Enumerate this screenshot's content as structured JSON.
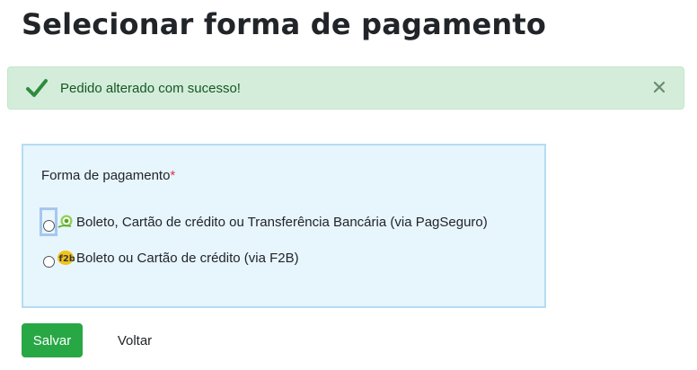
{
  "page": {
    "title": "Selecionar forma de pagamento"
  },
  "alert": {
    "message": "Pedido alterado com sucesso!",
    "icon": "check-icon",
    "close_icon": "close-icon",
    "color": "#d4edda"
  },
  "form": {
    "label": "Forma de pagamento",
    "required_mark": "*",
    "options": [
      {
        "label": "Boleto, Cartão de crédito ou Transferência Bancária (via PagSeguro)",
        "icon": "pagseguro-icon",
        "selected": false,
        "focused": true
      },
      {
        "label": "Boleto ou Cartão de crédito (via F2B)",
        "icon": "f2b-icon",
        "selected": false,
        "focused": false
      }
    ]
  },
  "actions": {
    "save_label": "Salvar",
    "back_label": "Voltar",
    "save_color": "#28a745"
  }
}
